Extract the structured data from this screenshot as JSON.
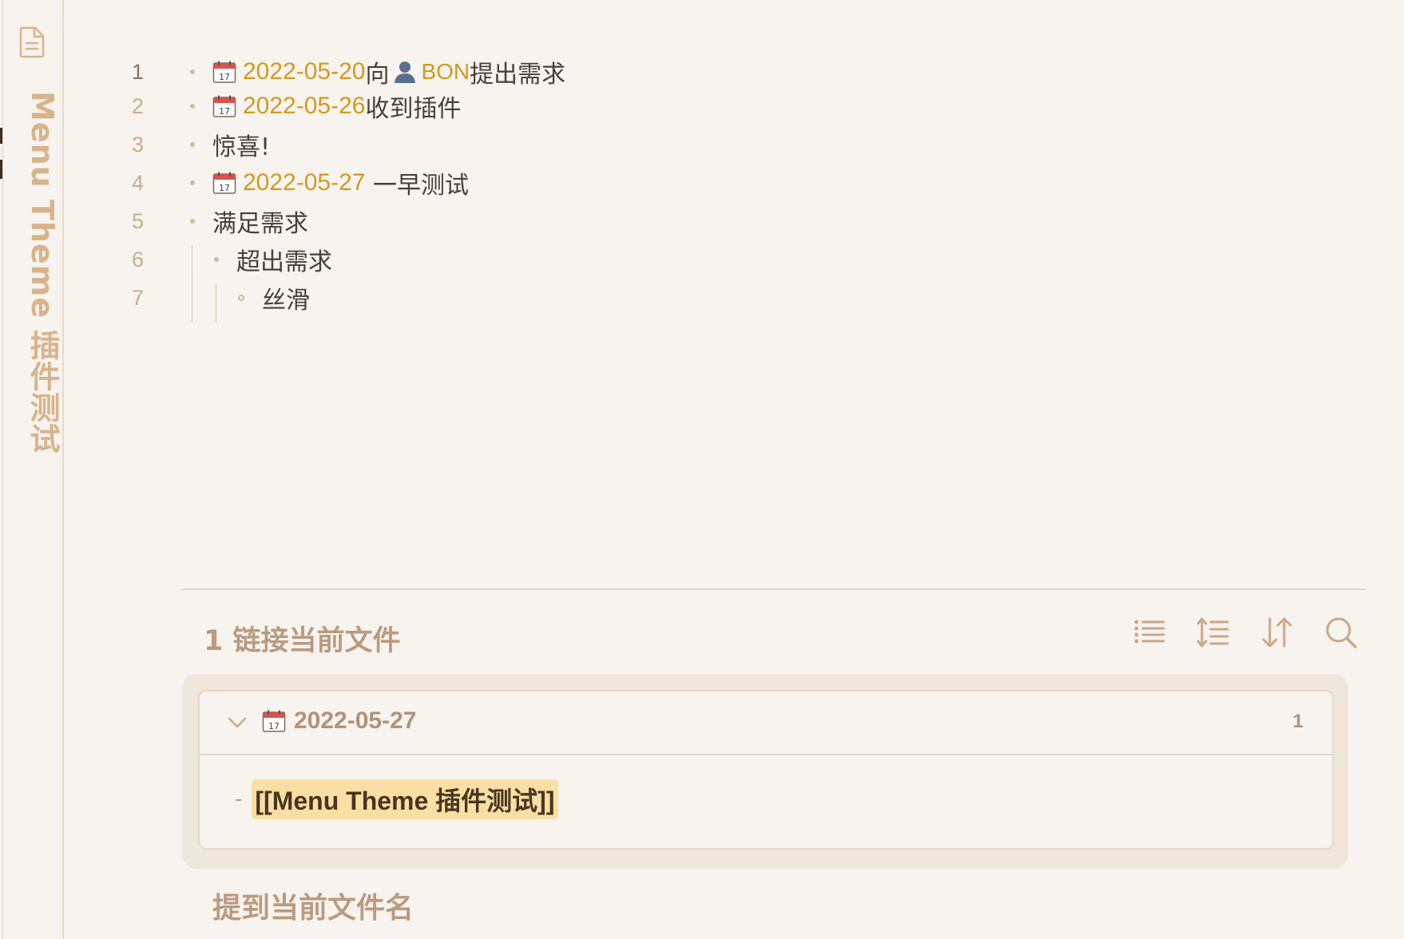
{
  "sidebar": {
    "doc_icon": "file-text-icon",
    "title": "Menu Theme 插件测试"
  },
  "editor": {
    "lines": [
      {
        "no": "1",
        "date": "2022-05-20",
        "text_a": "向",
        "mention": "BON",
        "text_b": "提出需求"
      },
      {
        "no": "2",
        "date": "2022-05-26",
        "text_a": "收到插件"
      },
      {
        "no": "3",
        "text_a": "惊喜!"
      },
      {
        "no": "4",
        "date": "2022-05-27",
        "text_a": " 一早测试"
      },
      {
        "no": "5",
        "text_a": "满足需求"
      },
      {
        "no": "6",
        "text_a": "超出需求"
      },
      {
        "no": "7",
        "text_a": "丝滑"
      }
    ]
  },
  "backlinks": {
    "header": "1  链接当前文件",
    "tools": [
      "list-icon",
      "line-spacing-icon",
      "sort-icon",
      "search-icon"
    ],
    "group": {
      "title": "2022-05-27",
      "count": "1",
      "ref_dash": "-",
      "ref_link": "[[Menu Theme 插件测试]]"
    }
  },
  "unlinked": {
    "header": "提到当前文件名"
  },
  "colors": {
    "background": "#f7f3ee",
    "accent": "#d29a1e",
    "muted": "#b99b80",
    "highlight": "#f9dfa3"
  }
}
